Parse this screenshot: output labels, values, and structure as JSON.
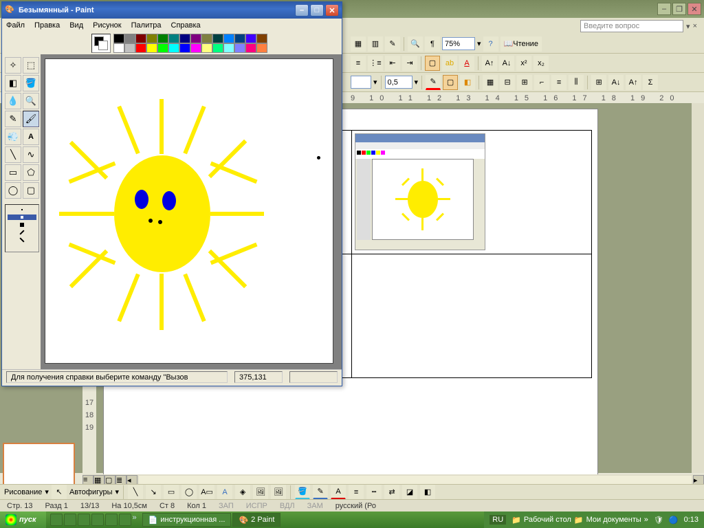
{
  "word": {
    "ask_placeholder": "Введите вопрос",
    "zoom": "75%",
    "reading_label": "Чтение",
    "linespacing": "0,5",
    "ruler_h": "9 10 11 12 13 14 15 16 17 18 19 20",
    "ruler_v": [
      "17",
      "18",
      "19"
    ],
    "draw_label": "Рисование",
    "autoshapes": "Автофигуры",
    "status": {
      "page": "Стр. 13",
      "section": "Разд 1",
      "pages": "13/13",
      "at": "На 10,5см",
      "line": "Ст 8",
      "col": "Кол 1",
      "rec": "ЗАП",
      "trk": "ИСПР",
      "ext": "ВДЛ",
      "ovr": "ЗАМ",
      "lang": "русский (Ро"
    }
  },
  "paint": {
    "title": "Безымянный - Paint",
    "menus": [
      "Файл",
      "Правка",
      "Вид",
      "Рисунок",
      "Палитра",
      "Справка"
    ],
    "status_help": "Для получения справки выберите команду \"Вызов",
    "coords": "375,131",
    "palette_row1": [
      "#000",
      "#808080",
      "#800000",
      "#808000",
      "#008000",
      "#008080",
      "#000080",
      "#800080",
      "#808040",
      "#004040",
      "#0080ff",
      "#004080",
      "#4000ff",
      "#804000"
    ],
    "palette_row2": [
      "#fff",
      "#c0c0c0",
      "#f00",
      "#ff0",
      "#0f0",
      "#0ff",
      "#00f",
      "#f0f",
      "#ffff80",
      "#00ff80",
      "#80ffff",
      "#8080ff",
      "#ff0080",
      "#ff8040"
    ]
  },
  "taskbar": {
    "start": "пуск",
    "tasks": [
      "инструкционная ...",
      "2 Paint"
    ],
    "lang": "RU",
    "desktop": "Рабочий стол",
    "mydocs": "Мои документы",
    "time": "0:13"
  }
}
